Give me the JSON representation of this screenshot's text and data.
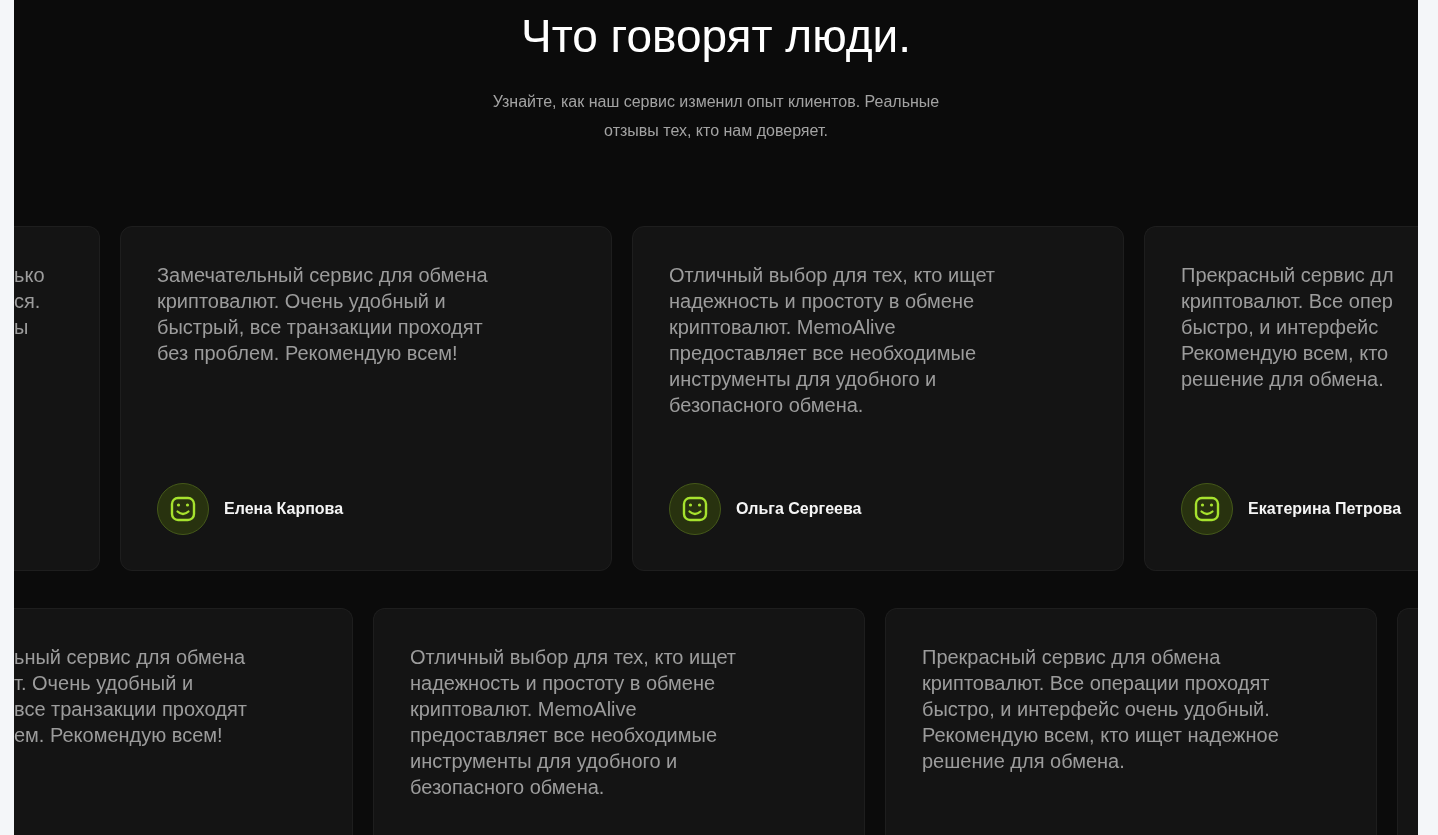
{
  "heading": "Что говорят люди.",
  "subtitle": {
    "lines": [
      "Узнайте, как наш сервис изменил опыт клиентов. Реальные",
      "отзывы тех, кто нам доверяет."
    ]
  },
  "rows": [
    {
      "cards": [
        {
          "kind": "cut_left",
          "lines": [
            "ько",
            "ся.",
            "ы"
          ]
        },
        {
          "kind": "full",
          "lines": [
            "Замечательный сервис для обмена",
            "криптовалют. Очень удобный и",
            "быстрый, все транзакции проходят",
            "без проблем. Рекомендую всем!"
          ],
          "author": {
            "name": "Елена Карпова"
          }
        },
        {
          "kind": "full",
          "lines": [
            "Отличный выбор для тех, кто ищет",
            "надежность и простоту в обмене",
            "криптовалют. MemoAlive",
            "предоставляет все необходимые",
            "инструменты для удобного и",
            "безопасного обмена."
          ],
          "author": {
            "name": "Ольга Сергеева"
          }
        },
        {
          "kind": "cut_right",
          "lines": [
            "Прекрасный сервис дл",
            "криптовалют. Все опер",
            "быстро, и интерфейс",
            "Рекомендую всем, кто",
            "решение для обмена."
          ],
          "author": {
            "name": "Екатерина Петрова"
          }
        }
      ]
    },
    {
      "cards": [
        {
          "kind": "cut_left",
          "lines": [
            "ьный сервис для обмена",
            "т. Очень удобный и",
            "все транзакции проходят",
            "ем. Рекомендую всем!"
          ]
        },
        {
          "kind": "full",
          "lines": [
            "Отличный выбор для тех, кто ищет",
            "надежность и простоту в обмене",
            "криптовалют. MemoAlive",
            "предоставляет все необходимые",
            "инструменты для удобного и",
            "безопасного обмена."
          ]
        },
        {
          "kind": "full",
          "lines": [
            "Прекрасный сервис для обмена",
            "криптовалют. Все операции проходят",
            "быстро, и интерфейс очень удобный.",
            "Рекомендую всем, кто ищет надежное",
            "решение для обмена."
          ]
        },
        {
          "kind": "cut_right"
        }
      ]
    }
  ]
}
